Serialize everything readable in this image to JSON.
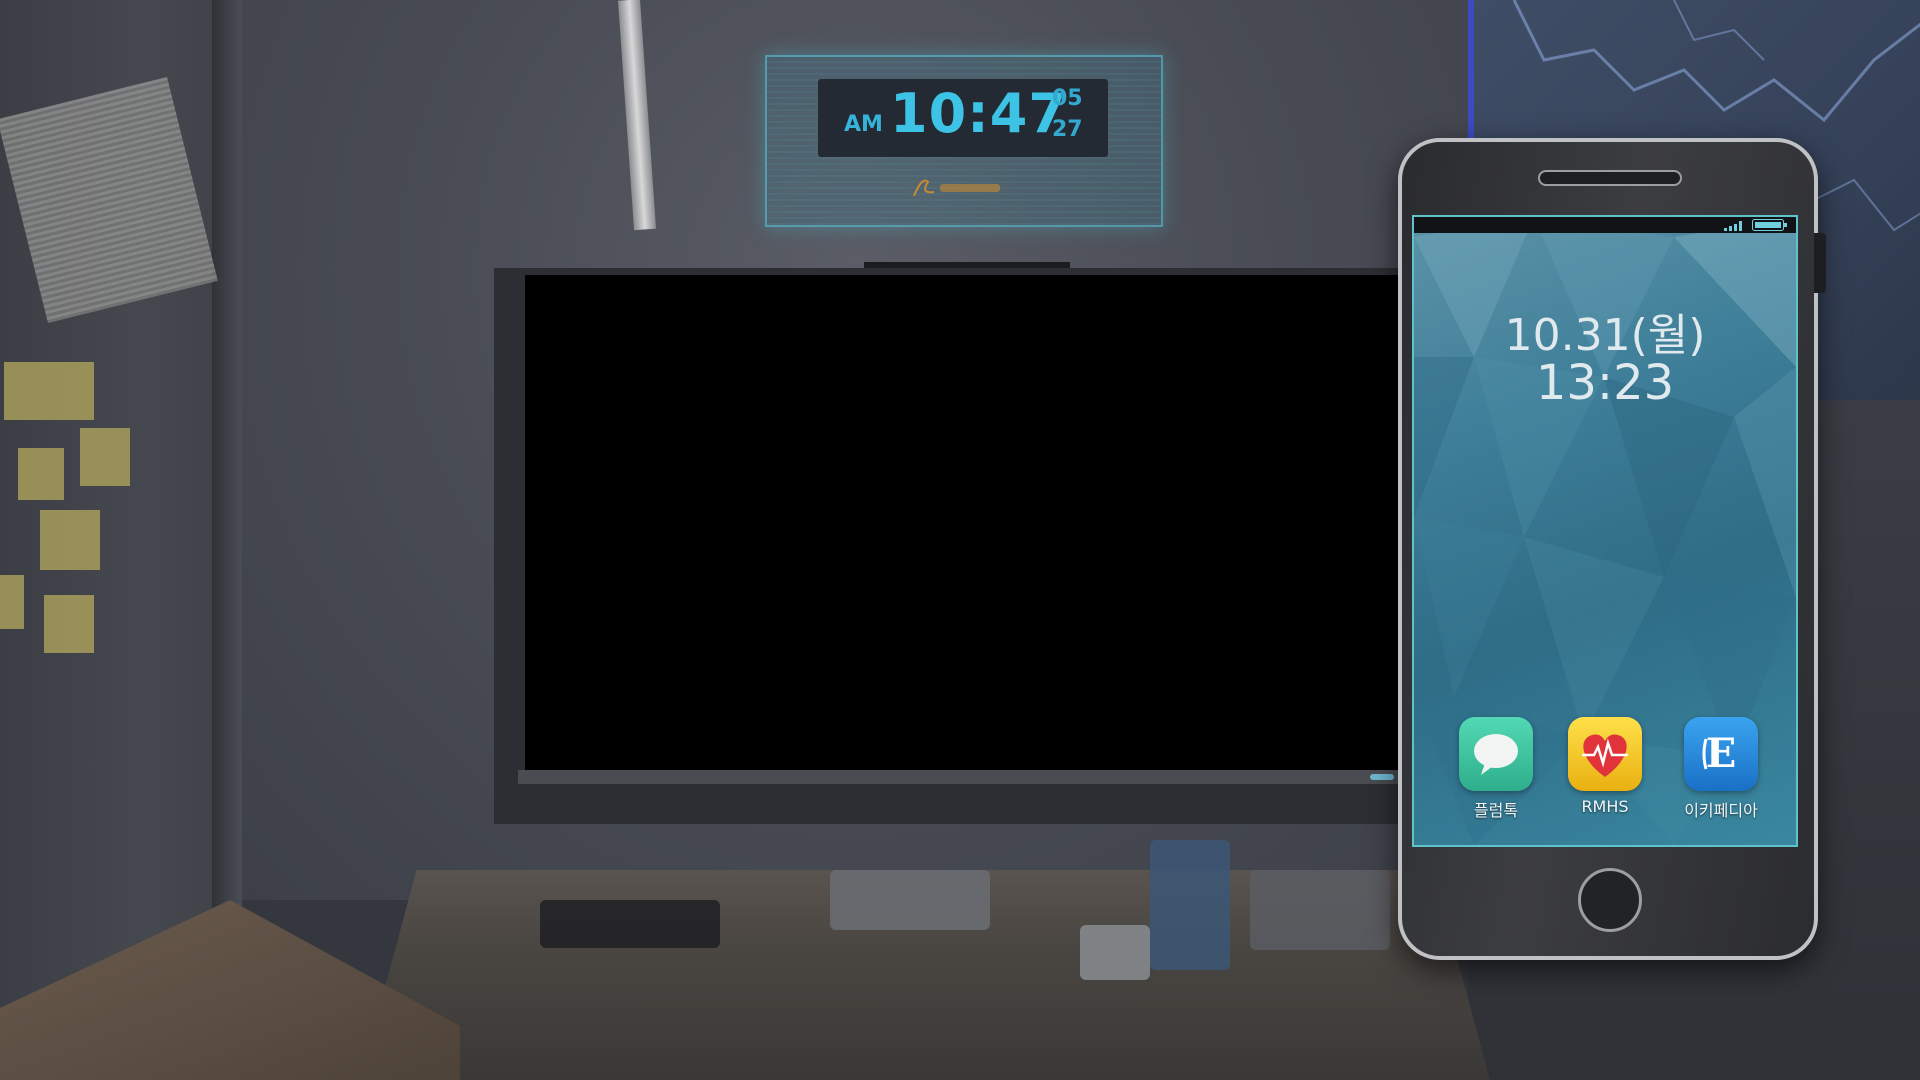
{
  "holo_clock": {
    "ampm": "AM",
    "time": "10:47",
    "month": "05",
    "day": "27"
  },
  "phone": {
    "date": "10.31(월)",
    "time": "13:23",
    "apps": [
      {
        "label": "플럼톡",
        "icon": "chat-bubble-icon",
        "color": "#3fc4a0"
      },
      {
        "label": "RMHS",
        "icon": "heart-pulse-icon",
        "color": "#f2c21e"
      },
      {
        "label": "이키페디아",
        "icon": "e-letter-icon",
        "color": "#2a8de0"
      }
    ]
  },
  "colors": {
    "screen_border": "#5fc4c9",
    "holo": "#3cc3e6",
    "map_border": "#3b4cc0"
  }
}
